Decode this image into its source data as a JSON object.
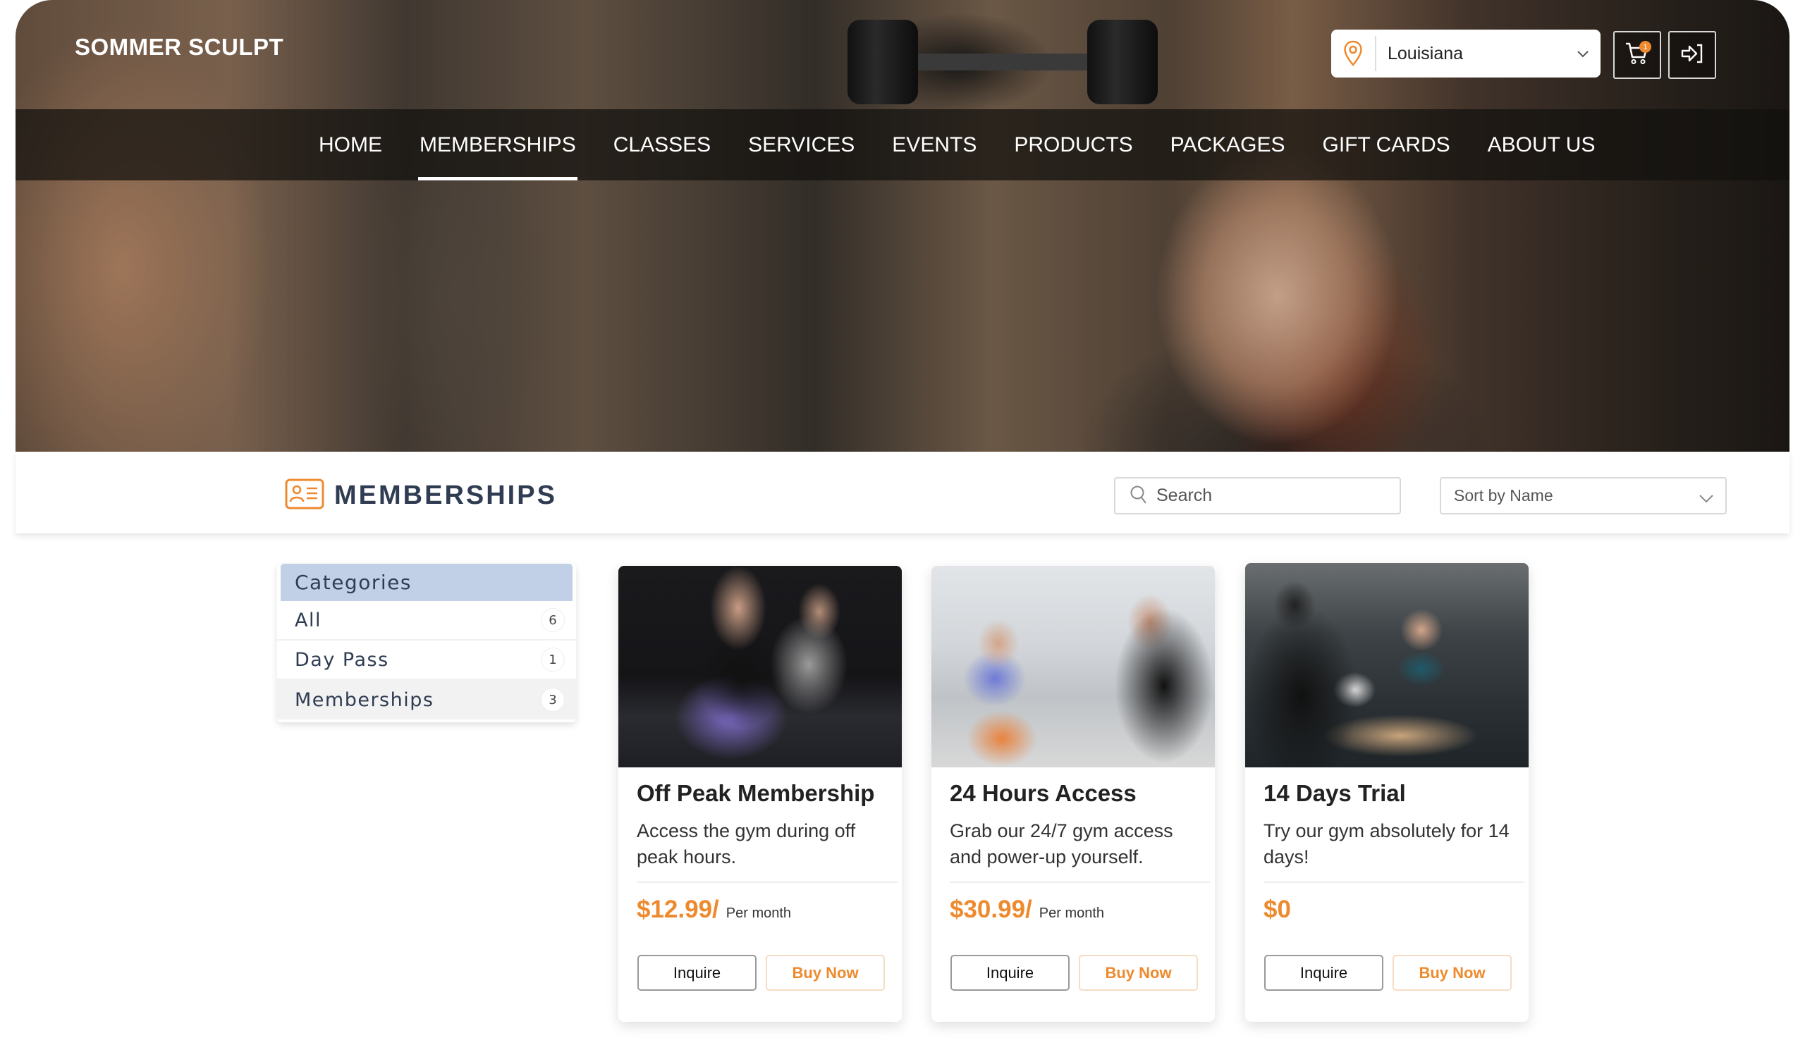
{
  "header": {
    "brand": "SOMMER SCULPT",
    "location": {
      "icon": "map-pin-icon",
      "selected": "Louisiana"
    },
    "cart": {
      "icon": "cart-icon",
      "badge_count": "1"
    },
    "login": {
      "icon": "sign-in-icon"
    }
  },
  "nav": {
    "items": [
      {
        "label": "HOME",
        "active": false
      },
      {
        "label": "MEMBERSHIPS",
        "active": true
      },
      {
        "label": "CLASSES",
        "active": false
      },
      {
        "label": "SERVICES",
        "active": false
      },
      {
        "label": "EVENTS",
        "active": false
      },
      {
        "label": "PRODUCTS",
        "active": false
      },
      {
        "label": "PACKAGES",
        "active": false
      },
      {
        "label": "GIFT CARDS",
        "active": false
      },
      {
        "label": "ABOUT US",
        "active": false
      }
    ]
  },
  "page": {
    "title": "MEMBERSHIPS",
    "title_icon": "id-card-icon",
    "search": {
      "placeholder": "Search",
      "value": ""
    },
    "sort": {
      "selected": "Sort by Name"
    }
  },
  "categories": {
    "heading": "Categories",
    "items": [
      {
        "label": "All",
        "count": "6"
      },
      {
        "label": "Day Pass",
        "count": "1"
      },
      {
        "label": "Memberships",
        "count": "3",
        "selected": true
      }
    ]
  },
  "cards": [
    {
      "title": "Off Peak Membership",
      "description": "Access the gym during off peak hours.",
      "price": "$12.99/",
      "period": "Per month",
      "inquire_label": "Inquire",
      "buy_label": "Buy Now"
    },
    {
      "title": "24 Hours Access",
      "description": "Grab our 24/7 gym access and power-up yourself.",
      "price": "$30.99/",
      "period": "Per month",
      "inquire_label": "Inquire",
      "buy_label": "Buy Now"
    },
    {
      "title": "14 Days Trial",
      "description": "Try our gym absolutely for 14 days!",
      "price": "$0",
      "period": "",
      "inquire_label": "Inquire",
      "buy_label": "Buy Now"
    }
  ],
  "colors": {
    "accent": "#ee8a2e",
    "title_text": "#2f3c52",
    "categories_header": "#c1d0e7"
  }
}
